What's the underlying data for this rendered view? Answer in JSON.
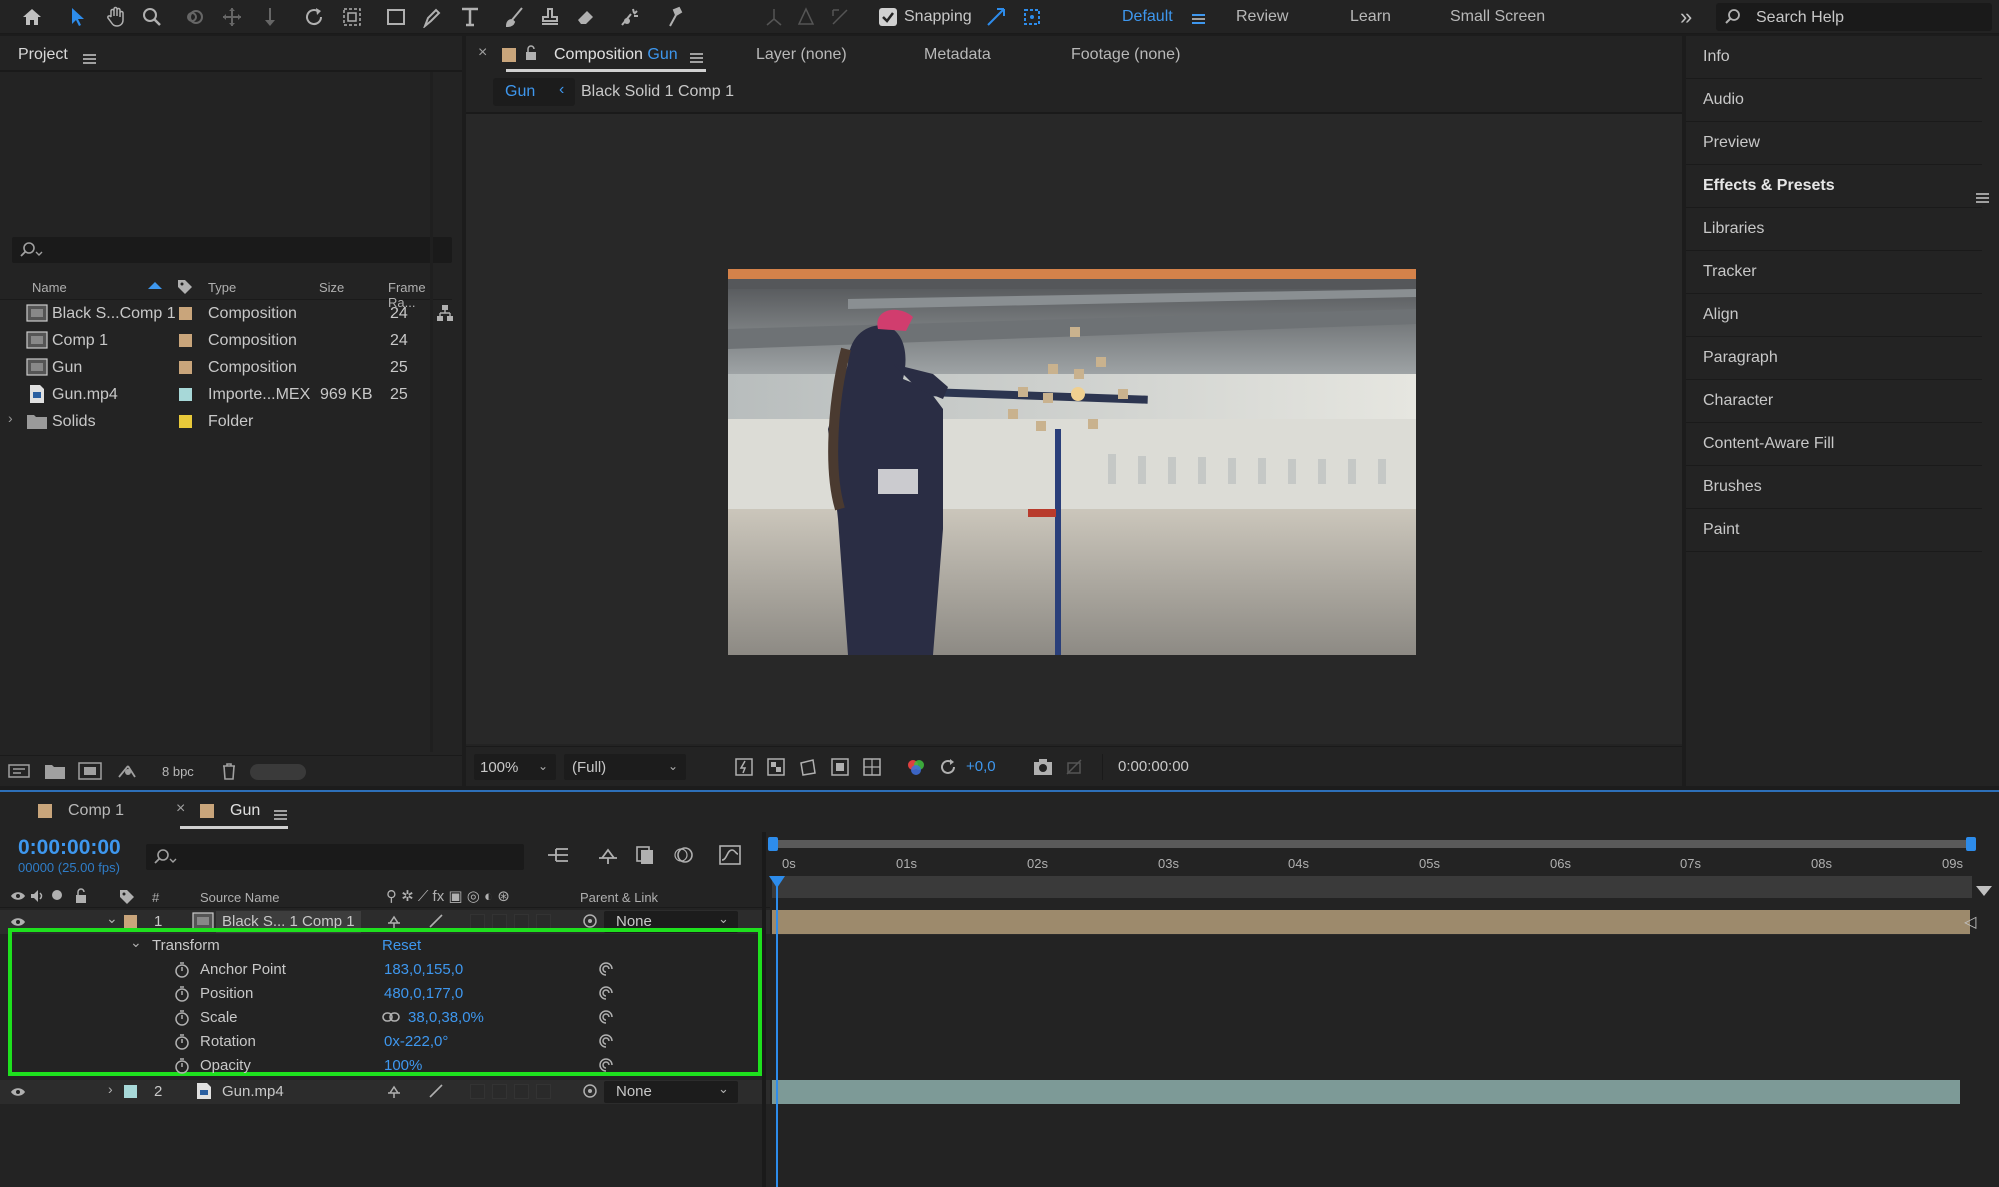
{
  "toolbar": {
    "snapping_label": "Snapping",
    "workspaces": [
      "Default",
      "Review",
      "Learn",
      "Small Screen"
    ],
    "search_placeholder": "Search Help",
    "accent": "#2d8ceb"
  },
  "project": {
    "title": "Project",
    "columns": [
      "Name",
      "Type",
      "Size",
      "Frame Ra..."
    ],
    "items": [
      {
        "name": "Black S...Comp 1",
        "type": "Composition",
        "size": "",
        "fps": "24",
        "color": "#c9a57b"
      },
      {
        "name": "Comp 1",
        "type": "Composition",
        "size": "",
        "fps": "24",
        "color": "#c9a57b"
      },
      {
        "name": "Gun",
        "type": "Composition",
        "size": "",
        "fps": "25",
        "color": "#c9a57b"
      },
      {
        "name": "Gun.mp4",
        "type": "Importe...MEX",
        "size": "969 KB",
        "fps": "25",
        "color": "#a7d8d8"
      },
      {
        "name": "Solids",
        "type": "Folder",
        "size": "",
        "fps": "",
        "color": "#e8c93a"
      }
    ],
    "bpc": "8 bpc"
  },
  "viewer": {
    "tab_prefix": "Composition",
    "tab_comp": "Gun",
    "tabs": [
      "Layer (none)",
      "Metadata",
      "Footage (none)"
    ],
    "breadcrumb": [
      "Gun",
      "Black Solid 1 Comp 1"
    ],
    "zoom": "100%",
    "resolution": "(Full)",
    "exposure": "+0,0",
    "timecode": "0:00:00:00"
  },
  "right_panels": [
    "Info",
    "Audio",
    "Preview",
    "Effects & Presets",
    "Libraries",
    "Tracker",
    "Align",
    "Paragraph",
    "Character",
    "Content-Aware Fill",
    "Brushes",
    "Paint"
  ],
  "timeline": {
    "tabs": [
      "Comp 1",
      "Gun"
    ],
    "timecode": "0:00:00:00",
    "frame_info": "00000 (25.00 fps)",
    "ruler": [
      "0s",
      "01s",
      "02s",
      "03s",
      "04s",
      "05s",
      "06s",
      "07s",
      "08s",
      "09s"
    ],
    "headers": {
      "num": "#",
      "source": "Source Name",
      "parent": "Parent & Link"
    },
    "layers": [
      {
        "num": "1",
        "name": "Black S... 1 Comp 1",
        "parent": "None",
        "bar_color": "#9d8a6c"
      },
      {
        "num": "2",
        "name": "Gun.mp4",
        "parent": "None",
        "bar_color": "#7d9a97"
      }
    ],
    "transform": {
      "label": "Transform",
      "reset": "Reset",
      "props": [
        {
          "name": "Anchor Point",
          "value": "183,0,155,0"
        },
        {
          "name": "Position",
          "value": "480,0,177,0"
        },
        {
          "name": "Scale",
          "value": "38,0,38,0%"
        },
        {
          "name": "Rotation",
          "value": "0x-222,0°"
        },
        {
          "name": "Opacity",
          "value": "100%"
        }
      ]
    }
  }
}
